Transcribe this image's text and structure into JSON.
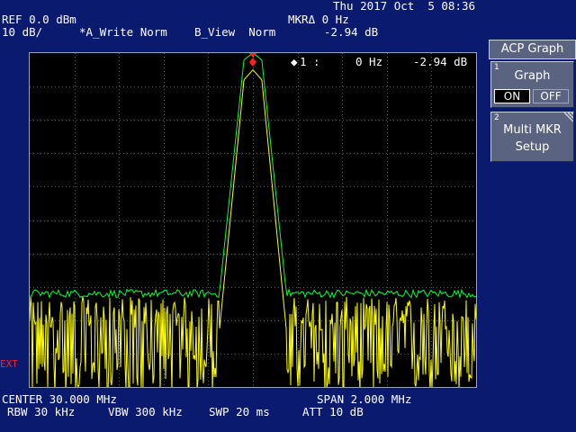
{
  "datetime": "Thu 2017 Oct  5 08:36",
  "header": {
    "ref_level": "REF 0.0 dBm",
    "scale": "10 dB/",
    "trace_a": "*A_Write Norm",
    "trace_b": "B_View  Norm",
    "marker_delta": "MKRΔ 0 Hz",
    "marker_delta_value": "-2.94 dB"
  },
  "marker_readout": {
    "symbol": "◆",
    "id": "1 :",
    "freq": "0 Hz",
    "value": "-2.94 dB"
  },
  "ext_label": "EXT",
  "footer": {
    "center": "CENTER 30.000 MHz",
    "span": "SPAN 2.000 MHz",
    "rbw": "RBW 30 kHz",
    "vbw": "VBW 300 kHz",
    "swp": "SWP 20 ms",
    "att": "ATT 10 dB"
  },
  "softkeys": {
    "title": "ACP Graph",
    "key1": {
      "number": "1",
      "label": "Graph",
      "on": "ON",
      "off": "OFF"
    },
    "key2": {
      "number": "2",
      "label_line1": "Multi MKR",
      "label_line2": "Setup"
    }
  },
  "colors": {
    "trace_a": "#ffff00",
    "trace_b": "#00ff33",
    "grid": "#5a5a5a",
    "marker": "#ff2020",
    "background": "#0a1a6e",
    "screen": "#000000"
  },
  "chart_data": {
    "type": "line",
    "x_center_mhz": 30.0,
    "x_span_mhz": 2.0,
    "xlim_mhz": [
      29.0,
      31.0
    ],
    "ylim_db": [
      -100,
      0
    ],
    "grid": true,
    "grid_divisions": {
      "x": 10,
      "y": 10
    },
    "series": [
      {
        "key": "trace_a",
        "color": "#ffff00",
        "x_mhz": [
          29.0,
          29.85,
          29.96,
          30.0,
          30.04,
          30.15,
          31.0
        ],
        "y_db": [
          -83,
          -83,
          -8,
          -5,
          -8,
          -83,
          -83
        ]
      },
      {
        "key": "trace_b",
        "color": "#00ff33",
        "x_mhz": [
          29.0,
          29.85,
          29.96,
          30.0,
          30.04,
          30.15,
          31.0
        ],
        "y_db": [
          -72,
          -72,
          -2,
          0,
          -2,
          -72,
          -72
        ]
      }
    ],
    "marker": {
      "x_mhz": 30.0,
      "y_db": 0
    }
  }
}
